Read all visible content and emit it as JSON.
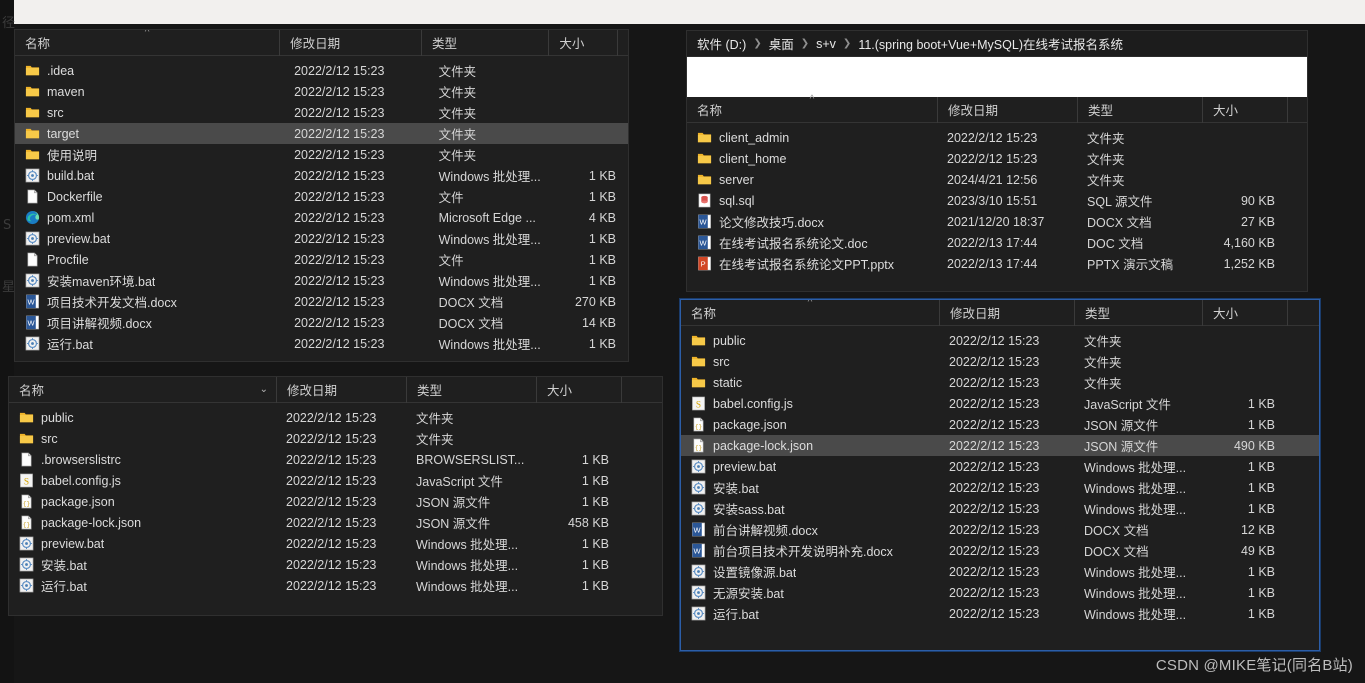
{
  "desktop": {
    "partial_text_top_left": "径",
    "partial_text_left_1": "S",
    "partial_text_left_2": "星",
    "watermark": "CSDN @MIKE笔记(同名B站)"
  },
  "colors": {
    "window_bg": "#1f1f1f",
    "selected_row": "#4a4a4a",
    "focus_border": "#2c5ea8",
    "folder_yellow": "#f5c344",
    "text": "#dcdcdc"
  },
  "columns": {
    "name": "名称",
    "date": "修改日期",
    "type": "类型",
    "size": "大小"
  },
  "windows": [
    {
      "id": "window-project-root",
      "has_breadcrumb": false,
      "focused": false,
      "sort_caret": "^",
      "name_chevron": "",
      "rows": [
        {
          "icon": "folder-icon",
          "name": ".idea",
          "date": "2022/2/12 15:23",
          "type": "文件夹",
          "size": "",
          "selected": false
        },
        {
          "icon": "folder-icon",
          "name": "maven",
          "date": "2022/2/12 15:23",
          "type": "文件夹",
          "size": "",
          "selected": false
        },
        {
          "icon": "folder-icon",
          "name": "src",
          "date": "2022/2/12 15:23",
          "type": "文件夹",
          "size": "",
          "selected": false
        },
        {
          "icon": "folder-icon",
          "name": "target",
          "date": "2022/2/12 15:23",
          "type": "文件夹",
          "size": "",
          "selected": true
        },
        {
          "icon": "folder-icon",
          "name": "使用说明",
          "date": "2022/2/12 15:23",
          "type": "文件夹",
          "size": "",
          "selected": false
        },
        {
          "icon": "bat-icon",
          "name": "build.bat",
          "date": "2022/2/12 15:23",
          "type": "Windows 批处理...",
          "size": "1 KB",
          "selected": false
        },
        {
          "icon": "file-blank-icon",
          "name": "Dockerfile",
          "date": "2022/2/12 15:23",
          "type": "文件",
          "size": "1 KB",
          "selected": false
        },
        {
          "icon": "edge-icon",
          "name": "pom.xml",
          "date": "2022/2/12 15:23",
          "type": "Microsoft Edge ...",
          "size": "4 KB",
          "selected": false
        },
        {
          "icon": "bat-icon",
          "name": "preview.bat",
          "date": "2022/2/12 15:23",
          "type": "Windows 批处理...",
          "size": "1 KB",
          "selected": false
        },
        {
          "icon": "file-blank-icon",
          "name": "Procfile",
          "date": "2022/2/12 15:23",
          "type": "文件",
          "size": "1 KB",
          "selected": false
        },
        {
          "icon": "bat-icon",
          "name": "安装maven环境.bat",
          "date": "2022/2/12 15:23",
          "type": "Windows 批处理...",
          "size": "1 KB",
          "selected": false
        },
        {
          "icon": "docx-icon",
          "name": "项目技术开发文档.docx",
          "date": "2022/2/12 15:23",
          "type": "DOCX 文档",
          "size": "270 KB",
          "selected": false
        },
        {
          "icon": "docx-icon",
          "name": "项目讲解视频.docx",
          "date": "2022/2/12 15:23",
          "type": "DOCX 文档",
          "size": "14 KB",
          "selected": false
        },
        {
          "icon": "bat-icon",
          "name": "运行.bat",
          "date": "2022/2/12 15:23",
          "type": "Windows 批处理...",
          "size": "1 KB",
          "selected": false
        }
      ]
    },
    {
      "id": "window-client-front",
      "has_breadcrumb": false,
      "focused": false,
      "sort_caret": "",
      "name_chevron": "⌄",
      "rows": [
        {
          "icon": "folder-icon",
          "name": "public",
          "date": "2022/2/12 15:23",
          "type": "文件夹",
          "size": "",
          "selected": false
        },
        {
          "icon": "folder-icon",
          "name": "src",
          "date": "2022/2/12 15:23",
          "type": "文件夹",
          "size": "",
          "selected": false
        },
        {
          "icon": "file-blank-icon",
          "name": ".browserslistrc",
          "date": "2022/2/12 15:23",
          "type": "BROWSERSLIST...",
          "size": "1 KB",
          "selected": false
        },
        {
          "icon": "js-icon",
          "name": "babel.config.js",
          "date": "2022/2/12 15:23",
          "type": "JavaScript 文件",
          "size": "1 KB",
          "selected": false
        },
        {
          "icon": "json-icon",
          "name": "package.json",
          "date": "2022/2/12 15:23",
          "type": "JSON 源文件",
          "size": "1 KB",
          "selected": false
        },
        {
          "icon": "json-icon",
          "name": "package-lock.json",
          "date": "2022/2/12 15:23",
          "type": "JSON 源文件",
          "size": "458 KB",
          "selected": false
        },
        {
          "icon": "bat-icon",
          "name": "preview.bat",
          "date": "2022/2/12 15:23",
          "type": "Windows 批处理...",
          "size": "1 KB",
          "selected": false
        },
        {
          "icon": "bat-icon",
          "name": "安装.bat",
          "date": "2022/2/12 15:23",
          "type": "Windows 批处理...",
          "size": "1 KB",
          "selected": false
        },
        {
          "icon": "bat-icon",
          "name": "运行.bat",
          "date": "2022/2/12 15:23",
          "type": "Windows 批处理...",
          "size": "1 KB",
          "selected": false
        }
      ]
    },
    {
      "id": "window-solution-root",
      "has_breadcrumb": true,
      "focused": false,
      "sort_caret": "^",
      "name_chevron": "",
      "breadcrumb": [
        "软件 (D:)",
        "桌面",
        "s+v",
        "11.(spring boot+Vue+MySQL)在线考试报名系统"
      ],
      "rows": [
        {
          "icon": "folder-icon",
          "name": "client_admin",
          "date": "2022/2/12 15:23",
          "type": "文件夹",
          "size": "",
          "selected": false
        },
        {
          "icon": "folder-icon",
          "name": "client_home",
          "date": "2022/2/12 15:23",
          "type": "文件夹",
          "size": "",
          "selected": false
        },
        {
          "icon": "folder-icon",
          "name": "server",
          "date": "2024/4/21 12:56",
          "type": "文件夹",
          "size": "",
          "selected": false
        },
        {
          "icon": "sql-icon",
          "name": "sql.sql",
          "date": "2023/3/10 15:51",
          "type": "SQL 源文件",
          "size": "90 KB",
          "selected": false
        },
        {
          "icon": "docx-icon",
          "name": "论文修改技巧.docx",
          "date": "2021/12/20 18:37",
          "type": "DOCX 文档",
          "size": "27 KB",
          "selected": false
        },
        {
          "icon": "docx-icon",
          "name": "在线考试报名系统论文.doc",
          "date": "2022/2/13 17:44",
          "type": "DOC 文档",
          "size": "4,160 KB",
          "selected": false
        },
        {
          "icon": "pptx-icon",
          "name": "在线考试报名系统论文PPT.pptx",
          "date": "2022/2/13 17:44",
          "type": "PPTX 演示文稿",
          "size": "1,252 KB",
          "selected": false
        }
      ]
    },
    {
      "id": "window-client-admin",
      "has_breadcrumb": false,
      "focused": true,
      "sort_caret": "^",
      "name_chevron": "",
      "rows": [
        {
          "icon": "folder-icon",
          "name": "public",
          "date": "2022/2/12 15:23",
          "type": "文件夹",
          "size": "",
          "selected": false
        },
        {
          "icon": "folder-icon",
          "name": "src",
          "date": "2022/2/12 15:23",
          "type": "文件夹",
          "size": "",
          "selected": false
        },
        {
          "icon": "folder-icon",
          "name": "static",
          "date": "2022/2/12 15:23",
          "type": "文件夹",
          "size": "",
          "selected": false
        },
        {
          "icon": "js-icon",
          "name": "babel.config.js",
          "date": "2022/2/12 15:23",
          "type": "JavaScript 文件",
          "size": "1 KB",
          "selected": false
        },
        {
          "icon": "json-icon",
          "name": "package.json",
          "date": "2022/2/12 15:23",
          "type": "JSON 源文件",
          "size": "1 KB",
          "selected": false
        },
        {
          "icon": "json-icon",
          "name": "package-lock.json",
          "date": "2022/2/12 15:23",
          "type": "JSON 源文件",
          "size": "490 KB",
          "selected": true
        },
        {
          "icon": "bat-icon",
          "name": "preview.bat",
          "date": "2022/2/12 15:23",
          "type": "Windows 批处理...",
          "size": "1 KB",
          "selected": false
        },
        {
          "icon": "bat-icon",
          "name": "安装.bat",
          "date": "2022/2/12 15:23",
          "type": "Windows 批处理...",
          "size": "1 KB",
          "selected": false
        },
        {
          "icon": "bat-icon",
          "name": "安装sass.bat",
          "date": "2022/2/12 15:23",
          "type": "Windows 批处理...",
          "size": "1 KB",
          "selected": false
        },
        {
          "icon": "docx-icon",
          "name": "前台讲解视频.docx",
          "date": "2022/2/12 15:23",
          "type": "DOCX 文档",
          "size": "12 KB",
          "selected": false
        },
        {
          "icon": "docx-icon",
          "name": "前台项目技术开发说明补充.docx",
          "date": "2022/2/12 15:23",
          "type": "DOCX 文档",
          "size": "49 KB",
          "selected": false
        },
        {
          "icon": "bat-icon",
          "name": "设置镜像源.bat",
          "date": "2022/2/12 15:23",
          "type": "Windows 批处理...",
          "size": "1 KB",
          "selected": false
        },
        {
          "icon": "bat-icon",
          "name": "无源安装.bat",
          "date": "2022/2/12 15:23",
          "type": "Windows 批处理...",
          "size": "1 KB",
          "selected": false
        },
        {
          "icon": "bat-icon",
          "name": "运行.bat",
          "date": "2022/2/12 15:23",
          "type": "Windows 批处理...",
          "size": "1 KB",
          "selected": false
        }
      ]
    }
  ]
}
